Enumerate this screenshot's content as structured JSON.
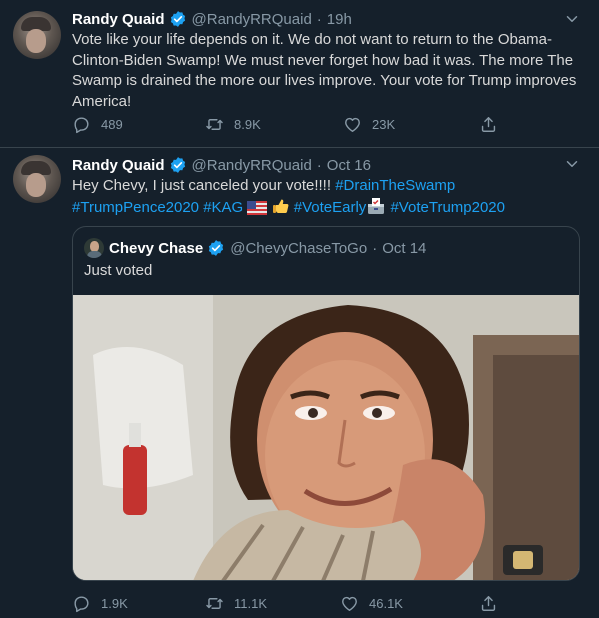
{
  "tweets": [
    {
      "author_name": "Randy Quaid",
      "handle": "@RandyRRQuaid",
      "separator": "·",
      "time": "19h",
      "text": "Vote like your life depends on it. We do not want to return to the Obama-Clinton-Biden Swamp! We must never forget how bad it was. The more The Swamp is drained the more our lives improve. Your vote for Trump improves America!",
      "replies": "489",
      "retweets": "8.9K",
      "likes": "23K"
    },
    {
      "author_name": "Randy Quaid",
      "handle": "@RandyRRQuaid",
      "separator": "·",
      "time": "Oct 16",
      "text_plain": "Hey Chevy, I just canceled your vote!!!! ",
      "hashtags": [
        "#DrainTheSwamp",
        "#TrumpPence2020",
        "#KAG",
        "#VoteEarly",
        "#VoteTrump2020"
      ],
      "emojis": [
        "us-flag",
        "thumbs-up",
        "ballot-box"
      ],
      "replies": "1.9K",
      "retweets": "11.1K",
      "likes": "46.1K",
      "quoted": {
        "author_name": "Chevy Chase",
        "handle": "@ChevyChaseToGo",
        "separator": "·",
        "time": "Oct 14",
        "text": "Just voted"
      }
    }
  ],
  "colors": {
    "background": "#15202b",
    "text": "#d9d9d9",
    "muted": "#8899a6",
    "link": "#1da1f2",
    "border": "#38444d"
  },
  "icons": [
    "verified-badge-icon",
    "chevron-down-icon",
    "reply-icon",
    "retweet-icon",
    "like-icon",
    "share-icon"
  ]
}
